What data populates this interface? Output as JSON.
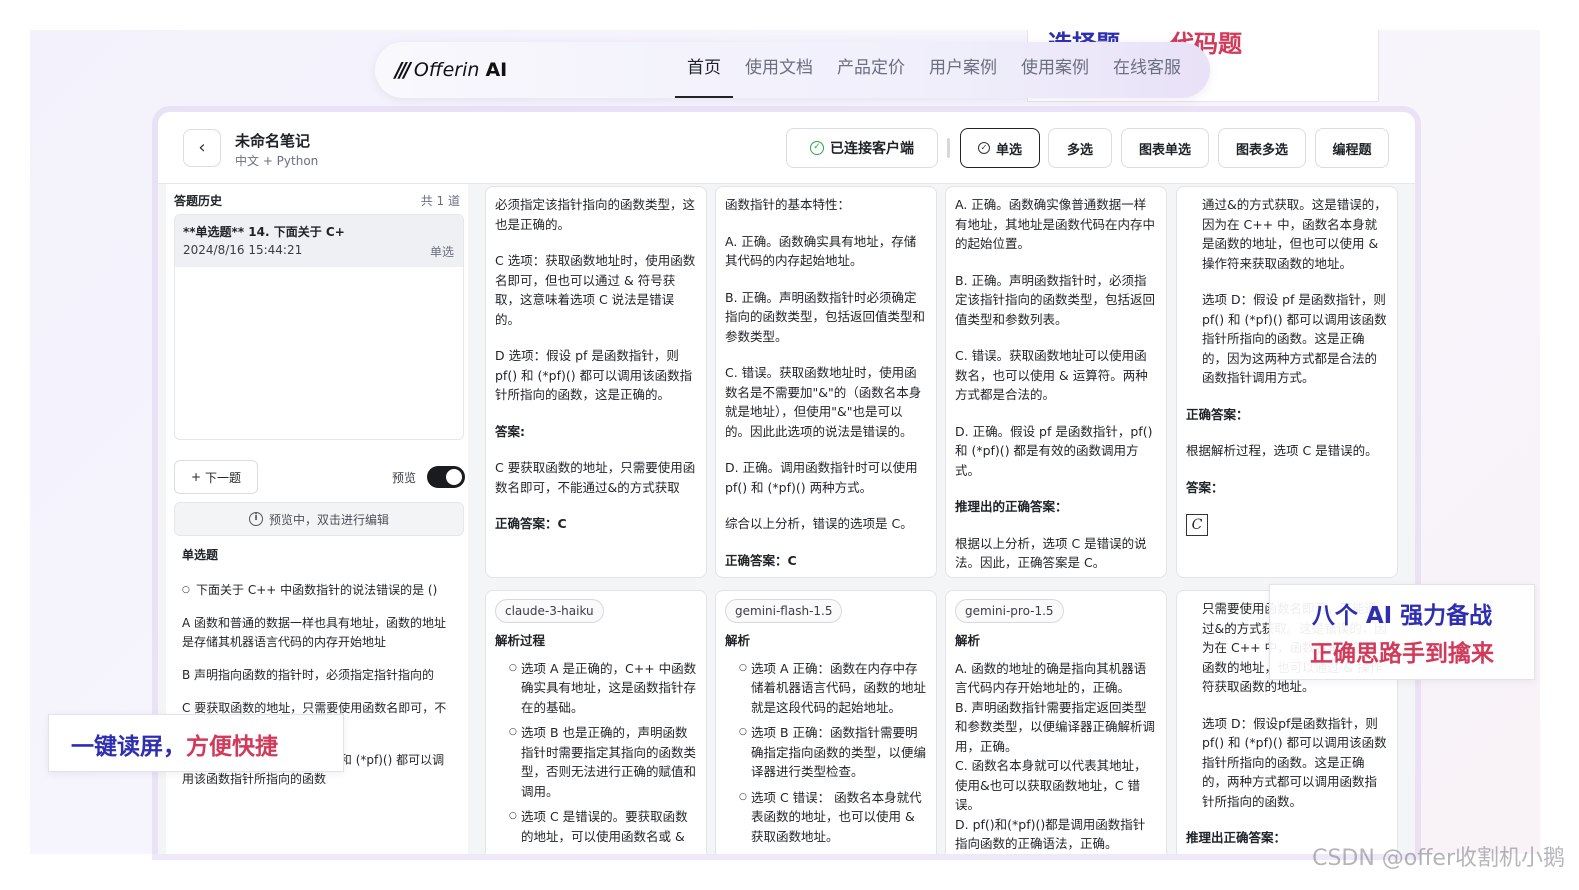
{
  "promo_top": {
    "part_a": "选择题",
    "part_b": "、代码题"
  },
  "nav": {
    "logo_mark": "///",
    "logo_word": "Offerin",
    "logo_ai": "AI",
    "links": [
      "首页",
      "使用文档",
      "产品定价",
      "用户案例",
      "使用案例",
      "在线客服"
    ]
  },
  "header": {
    "back_icon": "‹",
    "title": "未命名笔记",
    "subtitle": "中文 + Python",
    "connected": "已连接客户端",
    "modes": [
      "单选",
      "多选",
      "图表单选",
      "图表多选",
      "编程题"
    ]
  },
  "sidebar": {
    "history_title": "答题历史",
    "history_count": "共 1 道",
    "item_question": "**单选题** 14. 下面关于 C+",
    "item_date": "2024/8/16 15:44:21",
    "item_type": "单选",
    "next_label": "下一题",
    "preview_label": "预览",
    "preview_on": true,
    "info_text": "预览中，双击进行编辑",
    "question_type": "单选题",
    "question_text": "下面关于 C++ 中函数指针的说法错误的是 ()",
    "option_a": "A 函数和普通的数据一样也具有地址，函数的地址是存储其机器语言代码的内存开始地址",
    "option_b": "B 声明指向函数的指针时，必须指定指针指向的",
    "option_c": "C 要获取函数的地址，只需要使用函数名即可，不能通过&的方式获取",
    "option_d": "D 假设pf是函数指针，则pf() 和 (*pf)() 都可以调用该函数指针所指向的函数"
  },
  "callouts": {
    "left_a": "一键读屏，",
    "left_b": "方便快捷",
    "right_l1": "八个 AI 强力备战",
    "right_l2": "正确思路手到擒来"
  },
  "cards_top": [
    {
      "p1": "必须指定该指针指向的函数类型，这也是正确的。",
      "p2": "C 选项：获取函数地址时，使用函数名即可，但也可以通过 & 符号获取，这意味着选项 C 说法是错误的。",
      "p3": "D 选项：假设 pf 是函数指针，则 pf() 和 (*pf)() 都可以调用该函数指针所指向的函数，这是正确的。",
      "p4": "答案:",
      "p5": "C 要获取函数的地址，只需要使用函数名即可，不能通过&的方式获取",
      "p6": "正确答案：C"
    },
    {
      "p1": "函数指针的基本特性：",
      "p2": "A. 正确。函数确实具有地址，存储其代码的内存起始地址。",
      "p3": "B. 正确。声明函数指针时必须确定指向的函数类型，包括返回值类型和参数类型。",
      "p4": "C. 错误。获取函数地址时，使用函数名是不需要加\"&\"的（函数名本身就是地址），但使用\"&\"也是可以的。因此此选项的说法是错误的。",
      "p5": "D. 正确。调用函数指针时可以使用 pf() 和 (*pf)() 两种方式。",
      "p6": "综合以上分析，错误的选项是 C。",
      "p7": "正确答案：C"
    },
    {
      "p1": "A. 正确。函数确实像普通数据一样有地址，其地址是函数代码在内存中的起始位置。",
      "p2": "B. 正确。声明函数指针时，必须指定该指针指向的函数类型，包括返回值类型和参数列表。",
      "p3": "C. 错误。获取函数地址可以使用函数名，也可以使用 & 运算符。两种方式都是合法的。",
      "p4": "D. 正确。假设 pf 是函数指针，pf() 和 (*pf)() 都是有效的函数调用方式。",
      "p5": "推理出的正确答案：",
      "p6": "根据以上分析，选项 C 是错误的说法。因此，正确答案是 C。"
    },
    {
      "p1": "通过&的方式获取。这是错误的，因为在 C++ 中，函数名本身就是函数的地址，但也可以使用 & 操作符来获取函数的地址。",
      "p2": "选项 D：假设 pf 是函数指针，则 pf() 和 (*pf)() 都可以调用该函数指针所指向的函数。这是正确的，因为这两种方式都是合法的函数指针调用方式。",
      "p3": "正确答案：",
      "p4": "根据解析过程，选项 C 是错误的。",
      "p5": "答案：",
      "p6": "C"
    }
  ],
  "cards_bottom": [
    {
      "model": "claude-3-haiku",
      "heading": "解析过程",
      "li1": "选项 A 是正确的，C++ 中函数确实具有地址，这是函数指针存在的基础。",
      "li2": "选项 B 也是正确的，声明函数指针时需要指定其指向的函数类型，否则无法进行正确的赋值和调用。",
      "li3": "选项 C 是错误的。要获取函数的地址，可以使用函数名或 &"
    },
    {
      "model": "gemini-flash-1.5",
      "heading": "解析",
      "li1": "选项 A 正确：函数在内存中存储着机器语言代码，函数的地址就是这段代码的起始地址。",
      "li2": "选项 B 正确：函数指针需要明确指定指向函数的类型，以便编译器进行类型检查。",
      "li3": "选项 C 错误： 函数名本身就代表函数的地址，也可以使用 & 获取函数地址。"
    },
    {
      "model": "gemini-pro-1.5",
      "heading": "解析",
      "l1": "A. 函数的地址的确是指向其机器语言代码内存开始地址的，正确。",
      "l2": "B. 声明函数指针需要指定返回类型和参数类型，以便编译器正确解析调用，正确。",
      "l3": "C. 函数名本身就可以代表其地址，使用&也可以获取函数地址，C 错误。",
      "l4": "D. pf()和(*pf)()都是调用函数指针指向函数的正确语法，正确。"
    },
    {
      "p1": "只需要使用函数名即可，不能通过&的方式获取。这是错误的，因为在 C++ 中，函数名本身就是函数的地址，也可以通过 & 操作符获取函数的地址。",
      "p2": "选项 D：假设pf是函数指针，则pf() 和 (*pf)() 都可以调用该函数指针所指向的函数。这是正确的，两种方式都可以调用函数指针所指向的函数。",
      "p3": "推理出正确答案："
    }
  ],
  "watermark": "CSDN @offer收割机小鹅"
}
